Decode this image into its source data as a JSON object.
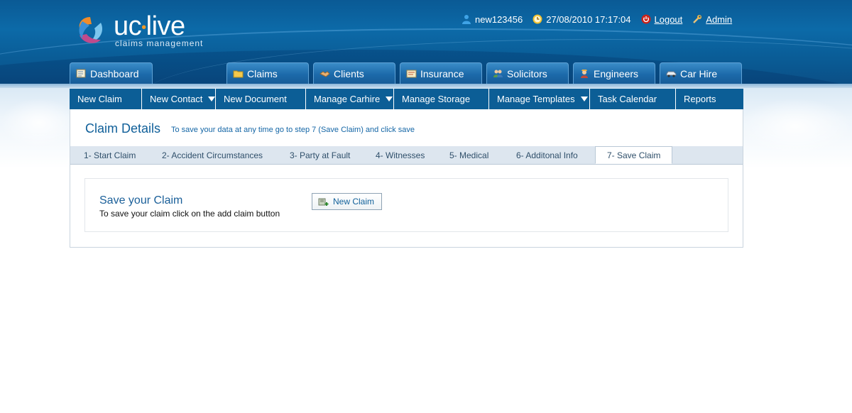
{
  "brand": {
    "name_left": "uc",
    "name_dot": "•",
    "name_right": "live",
    "tagline": "claims management",
    "colors": {
      "header": "#0a5a95",
      "accent": "#f59a23",
      "subnav": "#0c5e96"
    }
  },
  "userbar": {
    "username": "new123456",
    "datetime": "27/08/2010 17:17:04",
    "logout": "Logout",
    "admin": "Admin",
    "icons": [
      "user-icon",
      "clock-icon",
      "power-icon",
      "wrench-icon"
    ]
  },
  "tabs": [
    {
      "label": "Dashboard",
      "icon": "dashboard-icon"
    },
    {
      "label": "Claims",
      "icon": "folder-icon"
    },
    {
      "label": "Clients",
      "icon": "handshake-icon"
    },
    {
      "label": "Insurance",
      "icon": "document-icon"
    },
    {
      "label": "Solicitors",
      "icon": "people-icon"
    },
    {
      "label": "Engineers",
      "icon": "engineer-icon"
    },
    {
      "label": "Car Hire",
      "icon": "car-icon"
    }
  ],
  "subnav": [
    {
      "label": "New Claim"
    },
    {
      "label": "New Contact"
    },
    {
      "label": "New Document"
    },
    {
      "label": "Manage Carhire"
    },
    {
      "label": "Manage Storage"
    },
    {
      "label": "Manage Templates"
    },
    {
      "label": "Task Calendar"
    },
    {
      "label": "Reports"
    }
  ],
  "content": {
    "title": "Claim Details",
    "hint": "To save your data at any time go to step 7 (Save Claim) and click save",
    "steps": [
      "1- Start Claim",
      "2- Accident Circumstances",
      "3- Party at Fault",
      "4- Witnesses",
      "5- Medical",
      "6- Additonal Info",
      "7- Save Claim"
    ],
    "active_step": "7- Save Claim",
    "save_title": "Save your Claim",
    "save_desc": "To save your claim click on the add claim button",
    "new_claim_button": "New Claim"
  }
}
